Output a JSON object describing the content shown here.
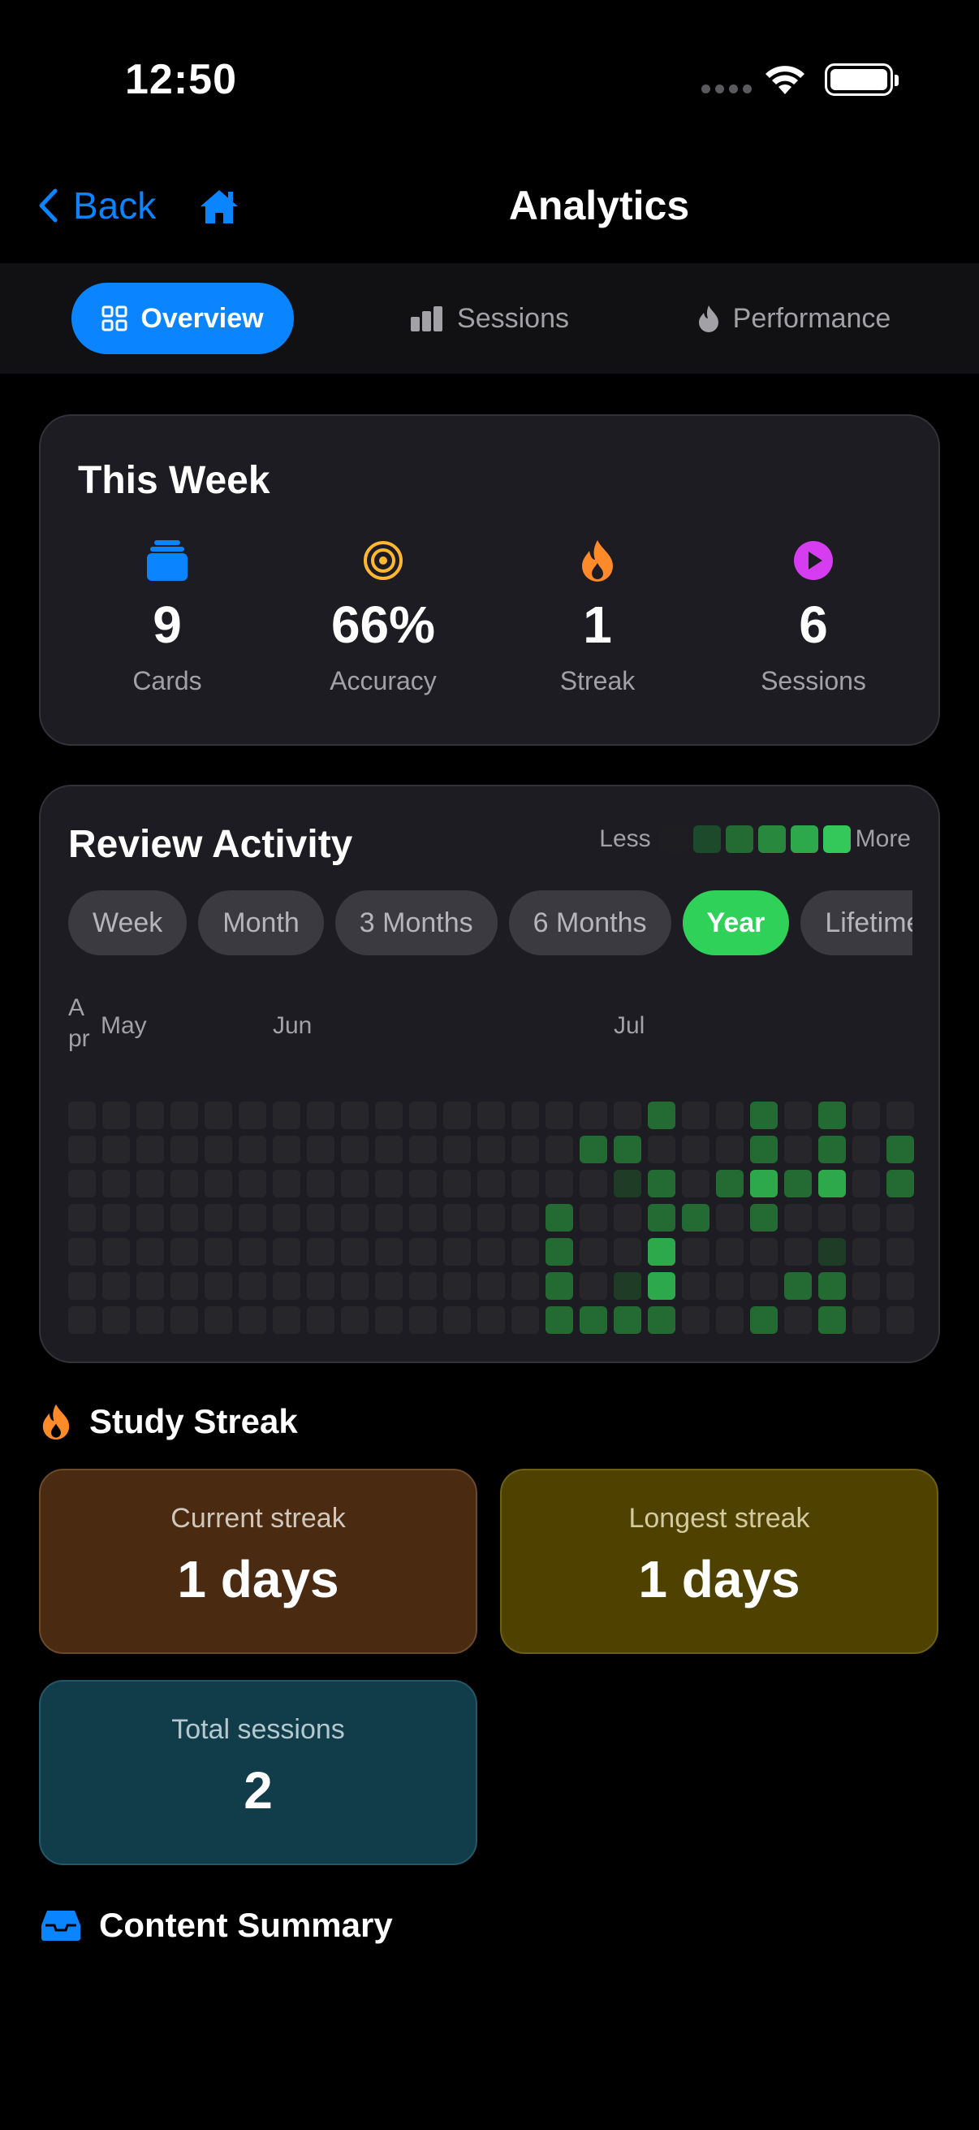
{
  "status": {
    "time": "12:50"
  },
  "nav": {
    "back_label": "Back",
    "title": "Analytics"
  },
  "tabs": [
    {
      "label": "Overview",
      "active": true
    },
    {
      "label": "Sessions",
      "active": false
    },
    {
      "label": "Performance",
      "active": false
    }
  ],
  "this_week": {
    "title": "This Week",
    "stats": [
      {
        "value": "9",
        "label": "Cards",
        "icon": "cards-stack-icon",
        "color": "#0a84ff"
      },
      {
        "value": "66%",
        "label": "Accuracy",
        "icon": "target-icon",
        "color": "#ffb830"
      },
      {
        "value": "1",
        "label": "Streak",
        "icon": "flame-icon",
        "color": "#ff8a2a"
      },
      {
        "value": "6",
        "label": "Sessions",
        "icon": "play-circle-icon",
        "color": "#d63cf0"
      }
    ]
  },
  "activity": {
    "title": "Review Activity",
    "legend_less": "Less",
    "legend_more": "More",
    "legend_colors": [
      "#1e1e22",
      "#1d4a2a",
      "#236a33",
      "#28883d",
      "#2da84a",
      "#34c759"
    ],
    "ranges": [
      "Week",
      "Month",
      "3 Months",
      "6 Months",
      "Year",
      "Lifetime"
    ],
    "active_range": "Year",
    "months": {
      "apr": "A pr",
      "may": "May",
      "jun": "Jun",
      "jul": "Jul"
    }
  },
  "streak": {
    "title": "Study Streak",
    "current_label": "Current streak",
    "current_value": "1 days",
    "longest_label": "Longest streak",
    "longest_value": "1 days",
    "total_label": "Total sessions",
    "total_value": "2"
  },
  "content_summary": {
    "title": "Content Summary"
  }
}
